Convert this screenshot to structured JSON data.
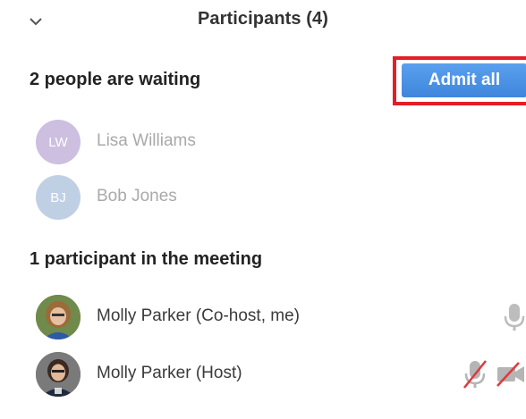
{
  "header": {
    "title": "Participants (4)",
    "collapse_icon": "chevron-down-icon"
  },
  "waiting": {
    "title": "2 people are waiting",
    "admit_all_label": "Admit all",
    "highlight_color": "#e41e26",
    "button_color": "#4a90e2",
    "people": [
      {
        "initials": "LW",
        "name": "Lisa Williams",
        "avatar_color": "#cdbfe0"
      },
      {
        "initials": "BJ",
        "name": "Bob Jones",
        "avatar_color": "#c0d0e4"
      }
    ]
  },
  "meeting": {
    "title": "1 participant in the meeting",
    "participants": [
      {
        "name": "Molly Parker (Co-host, me)",
        "mic": "microphone-icon",
        "video": ""
      },
      {
        "name": "Molly Parker (Host)",
        "mic": "microphone-muted-icon",
        "video": "video-off-icon"
      }
    ]
  }
}
